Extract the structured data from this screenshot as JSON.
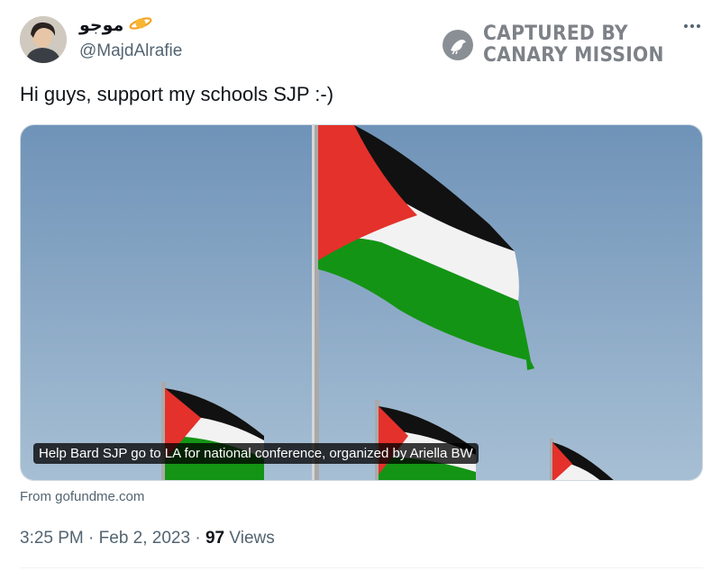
{
  "author": {
    "display_name": "موجو",
    "handle": "@MajdAlrafie",
    "badge_icon": "ringed-planet-emoji"
  },
  "watermark": {
    "line1": "CAPTURED BY",
    "line2": "CANARY MISSION"
  },
  "tweet": {
    "text": "Hi guys, support my schools SJP :-)"
  },
  "link_card": {
    "title": "Help Bard SJP go to LA for national conference, organized by Ariella BW",
    "domain": "From gofundme.com"
  },
  "meta": {
    "time": "3:25 PM",
    "separator": "·",
    "date": "Feb 2, 2023",
    "views_count": "97",
    "views_label": "Views"
  },
  "colors": {
    "flag_red": "#e4312b",
    "flag_black": "#111111",
    "flag_white": "#f2f2f2",
    "flag_green": "#149414",
    "sky": "#7ea0c0"
  }
}
